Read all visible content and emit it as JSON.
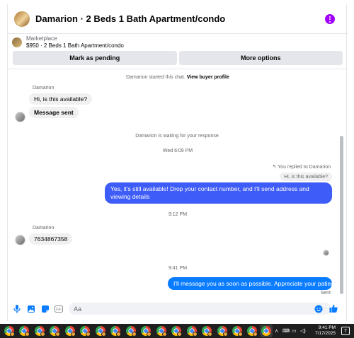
{
  "header": {
    "title": "Damarion · 2 Beds 1 Bath Apartment/condo"
  },
  "listing": {
    "label": "Marketplace",
    "summary": "$950 · 2 Beds 1 Bath Apartment/condo"
  },
  "actions": {
    "mark_pending": "Mark as pending",
    "more_options": "More options"
  },
  "chat": {
    "started_text": "Damarion started this chat.",
    "view_profile": "View buyer profile",
    "sender_name": "Damarion",
    "msg_available": "Hi, is this available?",
    "msg_sent_confirm": "Message sent",
    "waiting_text": "Damarion is waiting for your response.",
    "time_1": "Wed 6:09 PM",
    "reply_note": "You replied to Damarion",
    "quoted": "Hi, is this available?",
    "reply_text": "Yes, it's still available! Drop your contact number, and I'll send address and viewing details",
    "time_2": "9:12 PM",
    "sender_name_2": "Damarion",
    "msg_number": "7634867358",
    "time_3": "9:41 PM",
    "msg_final": "I'll message you as soon as possible. Appreciate your patience",
    "status": "Sent"
  },
  "composer": {
    "placeholder": "Aa"
  },
  "taskbar": {
    "time": "9:41 PM",
    "date": "7/17/2025",
    "notification_count": "7"
  },
  "colors": {
    "accent": "#0a7cff",
    "purple": "#a100ff"
  }
}
